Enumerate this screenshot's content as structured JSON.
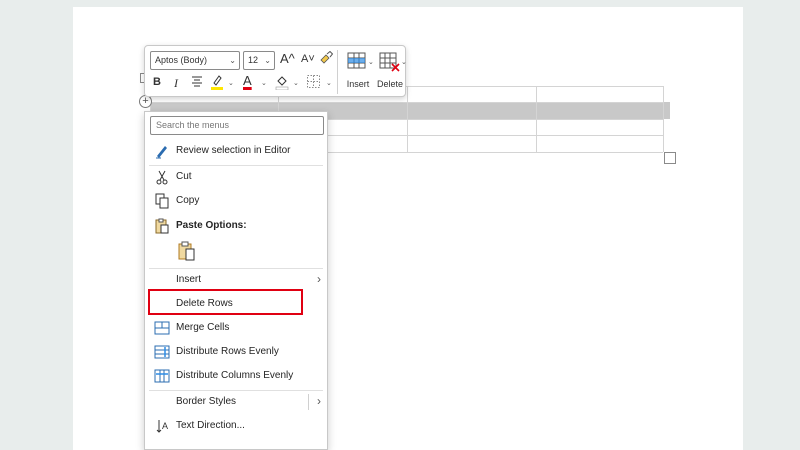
{
  "mini_toolbar": {
    "font_name": "Aptos (Body)",
    "font_size": "12",
    "grow_font": "A^",
    "shrink_font": "A˅",
    "bold": "B",
    "italic": "I",
    "font_color_letter": "A",
    "insert_label": "Insert",
    "delete_label": "Delete",
    "colors": {
      "highlight": "#ffe600",
      "font_color": "#e00012"
    }
  },
  "context_menu": {
    "search_placeholder": "Search the menus",
    "items": {
      "review": "Review selection in Editor",
      "cut": "Cut",
      "copy": "Copy",
      "paste_options": "Paste Options:",
      "insert": "Insert",
      "delete_rows": "Delete Rows",
      "merge_cells": "Merge Cells",
      "distribute_rows": "Distribute Rows Evenly",
      "distribute_columns": "Distribute Columns Evenly",
      "border_styles": "Border Styles",
      "text_direction": "Text Direction..."
    },
    "highlighted_item": "delete_rows",
    "highlight_color": "#e00012"
  }
}
